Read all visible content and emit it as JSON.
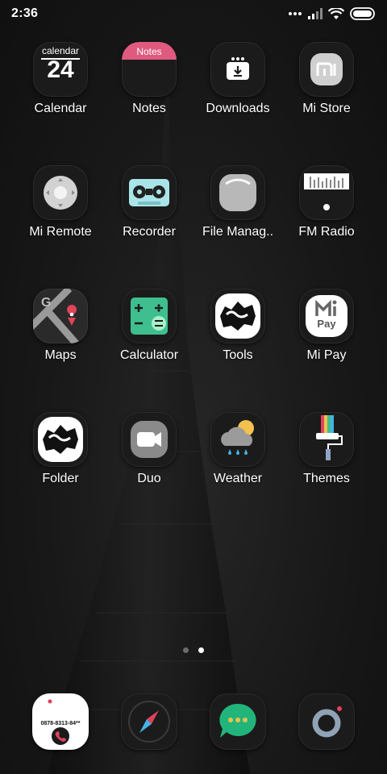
{
  "status_bar": {
    "time": "2:36",
    "icons": [
      "dots-icon",
      "signal-icon",
      "wifi-icon",
      "battery-icon"
    ]
  },
  "apps": [
    {
      "label": "Calendar",
      "icon": "calendar-icon",
      "badge_month": "calendar",
      "badge_day": "24"
    },
    {
      "label": "Notes",
      "icon": "notes-icon",
      "badge_title": "Notes"
    },
    {
      "label": "Downloads",
      "icon": "download-icon"
    },
    {
      "label": "Mi Store",
      "icon": "mi-store-icon"
    },
    {
      "label": "Mi Remote",
      "icon": "remote-icon"
    },
    {
      "label": "Recorder",
      "icon": "cassette-icon"
    },
    {
      "label": "File Manag..",
      "icon": "file-manager-icon"
    },
    {
      "label": "FM Radio",
      "icon": "radio-icon"
    },
    {
      "label": "Maps",
      "icon": "map-icon"
    },
    {
      "label": "Calculator",
      "icon": "calculator-icon"
    },
    {
      "label": "Tools",
      "icon": "tools-icon"
    },
    {
      "label": "Mi Pay",
      "icon": "mi-pay-icon",
      "badge_text": "Pay"
    },
    {
      "label": "Folder",
      "icon": "folder-icon"
    },
    {
      "label": "Duo",
      "icon": "video-camera-icon"
    },
    {
      "label": "Weather",
      "icon": "weather-icon"
    },
    {
      "label": "Themes",
      "icon": "paint-roller-icon"
    }
  ],
  "page_indicator": {
    "pages": 2,
    "active": 2
  },
  "dock": [
    {
      "icon": "phone-icon",
      "number_text": "0878-8313-84**"
    },
    {
      "icon": "compass-icon"
    },
    {
      "icon": "message-icon"
    },
    {
      "icon": "camera-icon"
    }
  ],
  "colors": {
    "notes_accent": "#e05a80",
    "recorder_accent": "#a8e4e8",
    "calculator_accent": "#3fbf8f",
    "message_accent": "#21b57b",
    "duo_accent": "#8a8a8a"
  }
}
